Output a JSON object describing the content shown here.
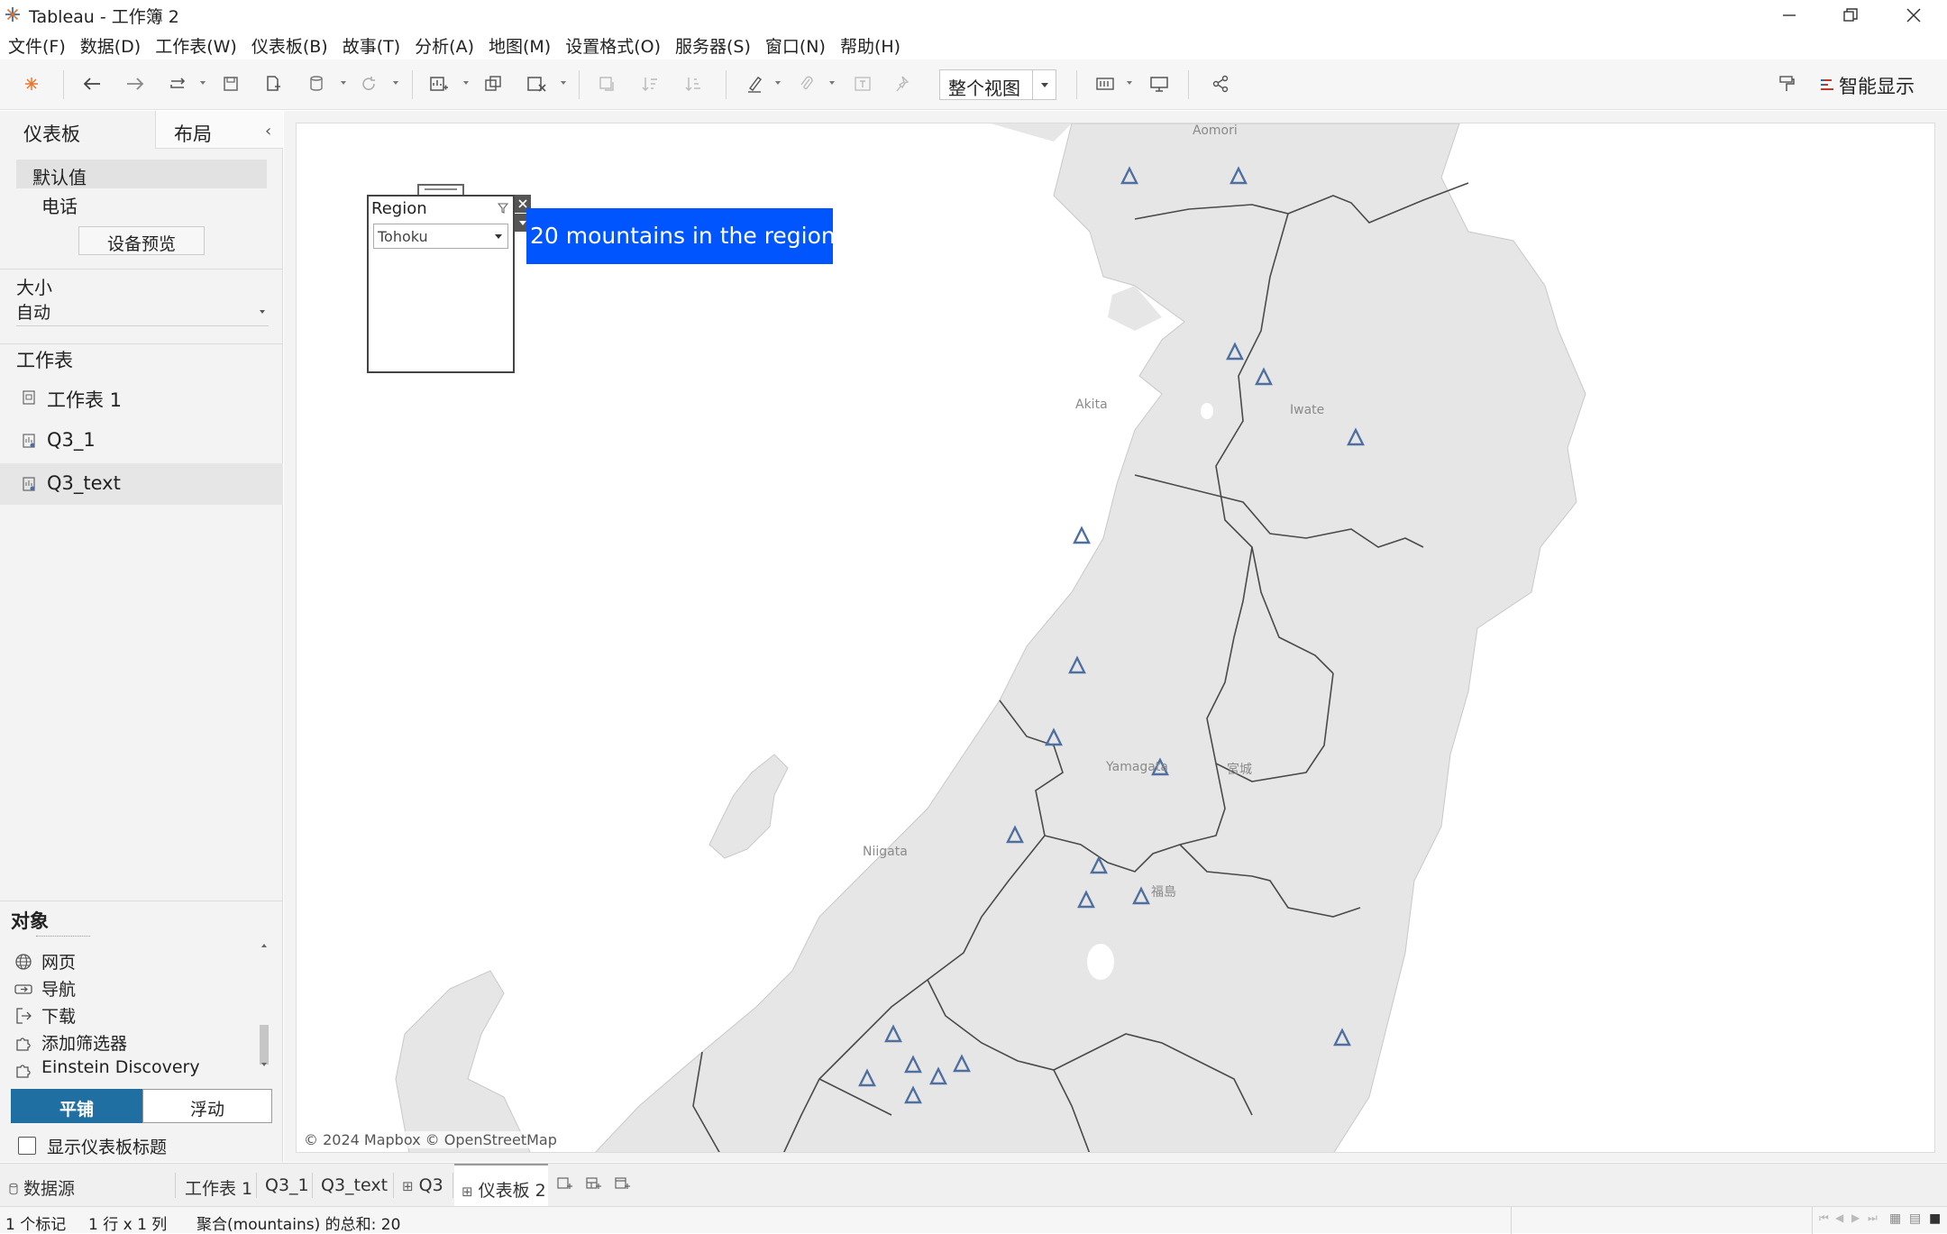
{
  "window": {
    "title": "Tableau - 工作簿 2"
  },
  "menu": [
    "文件(F)",
    "数据(D)",
    "工作表(W)",
    "仪表板(B)",
    "故事(T)",
    "分析(A)",
    "地图(M)",
    "设置格式(O)",
    "服务器(S)",
    "窗口(N)",
    "帮助(H)"
  ],
  "toolbar": {
    "view_mode": "整个视图",
    "smart_display": "智能显示"
  },
  "left_panel": {
    "tabs": [
      "仪表板",
      "布局"
    ],
    "devices": {
      "default": "默认值",
      "phone": "电话"
    },
    "device_preview": "设备预览",
    "size": {
      "label": "大小",
      "value": "自动"
    },
    "sheets_label": "工作表",
    "sheets": [
      "工作表 1",
      "Q3_1",
      "Q3_text"
    ],
    "objects_label": "对象",
    "objects": [
      "网页",
      "导航",
      "下载",
      "添加筛选器",
      "Einstein Discovery"
    ],
    "layout_buttons": {
      "tiled": "平铺",
      "floating": "浮动"
    },
    "show_title": "显示仪表板标题"
  },
  "dashboard": {
    "filter": {
      "title": "Region",
      "value": "Tohoku"
    },
    "banner": "20 mountains in the region",
    "attribution": "© 2024 Mapbox © OpenStreetMap",
    "map_labels": [
      "Aomori",
      "Akita",
      "Iwate",
      "Yamagata",
      "宮城",
      "Niigata",
      "福島"
    ]
  },
  "sheet_tabs": {
    "datasource": "数据源",
    "tabs": [
      "工作表 1",
      "Q3_1",
      "Q3_text",
      "Q3",
      "仪表板 2"
    ]
  },
  "status": {
    "marks": "1 个标记",
    "rows_cols": "1 行 x 1 列",
    "aggregate": "聚合(mountains) 的总和: 20"
  },
  "colors": {
    "banner": "#0055ff",
    "tiled_active": "#1f6fa3",
    "marker": "#4e6fa0",
    "land": "#e8e8e8"
  }
}
